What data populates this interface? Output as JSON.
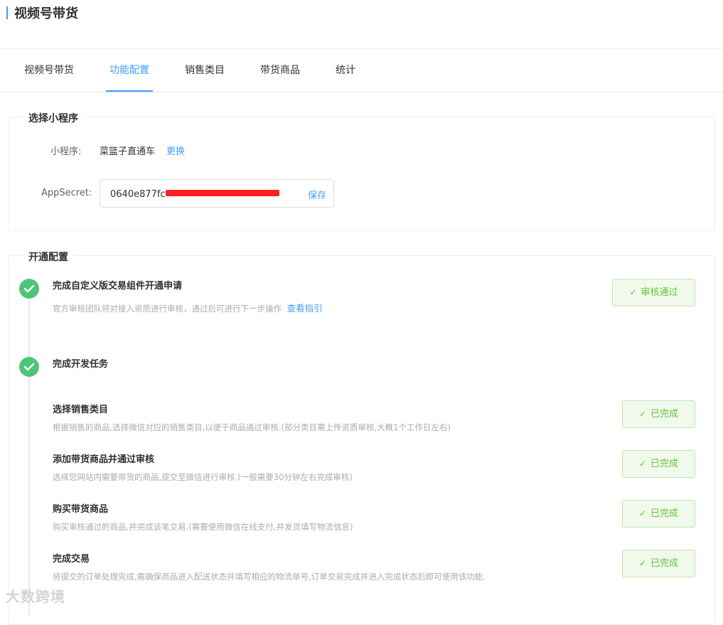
{
  "header": {
    "title": "视频号带货"
  },
  "tabs": [
    {
      "label": "视频号带货"
    },
    {
      "label": "功能配置"
    },
    {
      "label": "销售类目"
    },
    {
      "label": "带货商品"
    },
    {
      "label": "统计"
    }
  ],
  "miniprogram_section": {
    "legend": "选择小程序",
    "program_label": "小程序:",
    "program_name": "菜篮子直通车",
    "change_link": "更换",
    "secret_label": "AppSecret:",
    "secret_value": "0640e877fc",
    "save_label": "保存"
  },
  "config_section": {
    "legend": "开通配置",
    "step1": {
      "title": "完成自定义版交易组件开通申请",
      "desc": "官方审核团队将对接入资质进行审核，通过后可进行下一步操作",
      "guide_link": "查看指引",
      "status": "审核通过"
    },
    "step2": {
      "title": "完成开发任务"
    },
    "tasks": [
      {
        "title": "选择销售类目",
        "desc": "根据销售的商品,选择微信对应的销售类目,以便于商品通过审核.(部分类目需上传资质审核,大概1个工作日左右)",
        "status": "已完成"
      },
      {
        "title": "添加带货商品并通过审核",
        "desc": "选择您网站内需要带货的商品,提交至微信进行审核.(一般需要30分钟左右完成审核)",
        "status": "已完成"
      },
      {
        "title": "购买带货商品",
        "desc": "购买审核通过的商品,并完成该笔交易.(需要使用微信在线支付,并发货填写物流信息)",
        "status": "已完成"
      },
      {
        "title": "完成交易",
        "desc": "将提交的订单处理完成,需确保商品进入配送状态并填写相应的物流单号,订单交易完成并进入完成状态后即可使用该功能.",
        "status": "已完成"
      }
    ]
  },
  "watermark": "大数跨境",
  "colors": {
    "accent": "#409eff",
    "success": "#67c23a",
    "check_circle": "#4fc57a"
  }
}
